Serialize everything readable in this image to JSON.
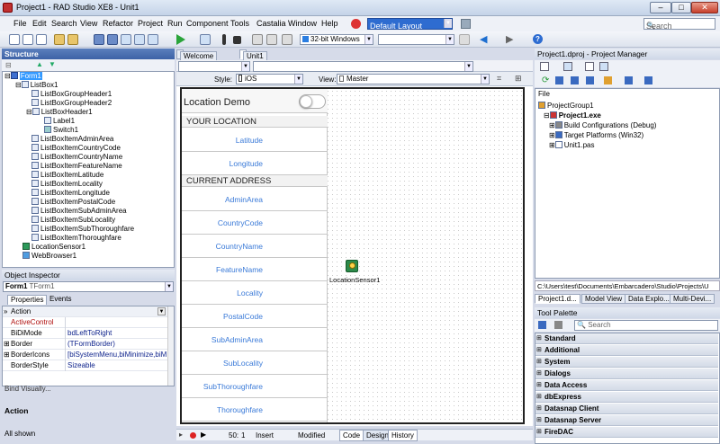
{
  "window": {
    "title": "Project1 - RAD Studio XE8 - Unit1"
  },
  "menu": [
    "File",
    "Edit",
    "Search",
    "View",
    "Refactor",
    "Project",
    "Run",
    "Component",
    "Tools",
    "Castalia",
    "Window",
    "Help"
  ],
  "toolbar": {
    "layout_combo": "Default Layout",
    "search_placeholder": "Search",
    "platform_combo": "32-bit Windows"
  },
  "structure": {
    "title": "Structure",
    "items": [
      "Form1",
      "ListBox1",
      "ListBoxGroupHeader1",
      "ListBoxGroupHeader2",
      "ListBoxHeader1",
      "Label1",
      "Switch1",
      "ListBoxItemAdminArea",
      "ListBoxItemCountryCode",
      "ListBoxItemCountryName",
      "ListBoxItemFeatureName",
      "ListBoxItemLatitude",
      "ListBoxItemLocality",
      "ListBoxItemLongitude",
      "ListBoxItemPostalCode",
      "ListBoxItemSubAdminArea",
      "ListBoxItemSubLocality",
      "ListBoxItemSubThoroughfare",
      "ListBoxItemThoroughfare",
      "LocationSensor1",
      "WebBrowser1"
    ]
  },
  "object_inspector": {
    "title": "Object Inspector",
    "object": "Form1",
    "object_type": "TForm1",
    "tabs": [
      "Properties",
      "Events"
    ],
    "search": "Action",
    "rows": [
      {
        "name": "ActiveControl",
        "value": ""
      },
      {
        "name": "BiDiMode",
        "value": "bdLeftToRight"
      },
      {
        "name": "Border",
        "value": "(TFormBorder)"
      },
      {
        "name": "BorderIcons",
        "value": "[biSystemMenu,biMinimize,biMa"
      },
      {
        "name": "BorderStyle",
        "value": "Sizeable"
      }
    ],
    "bind_visually": "Bind Visually...",
    "desc_title": "Action",
    "status": "All shown"
  },
  "editor": {
    "tabs": [
      "Welcome Page",
      "Unit1"
    ],
    "style_label": "Style:",
    "style_value": "iOS",
    "view_label": "View:",
    "view_value": "Master"
  },
  "form": {
    "title": "Location Demo",
    "header_location": "YOUR LOCATION",
    "header_address": "CURRENT ADDRESS",
    "location_items": [
      "Latitude",
      "Longitude"
    ],
    "address_items": [
      "AdminArea",
      "CountryCode",
      "CountryName",
      "FeatureName",
      "Locality",
      "PostalCode",
      "SubAdminArea",
      "SubLocality",
      "SubThoroughfare",
      "Thoroughfare"
    ],
    "sensor_label": "LocationSensor1"
  },
  "statusbar": {
    "line": "50:",
    "col": "1",
    "mode": "Insert",
    "modified": "Modified",
    "tabs": [
      "Code",
      "Design",
      "History"
    ]
  },
  "project_manager": {
    "title": "Project1.dproj - Project Manager",
    "file_label": "File",
    "items": [
      "ProjectGroup1",
      "Project1.exe",
      "Build Configurations (Debug)",
      "Target Platforms (Win32)",
      "Unit1.pas"
    ],
    "path": "C:\\Users\\test\\Documents\\Embarcadero\\Studio\\Projects\\U",
    "tabs": [
      "Project1.d...",
      "Model View",
      "Data Explo...",
      "Multi-Devi..."
    ]
  },
  "tool_palette": {
    "title": "Tool Palette",
    "search_placeholder": "Search",
    "categories": [
      "Standard",
      "Additional",
      "System",
      "Dialogs",
      "Data Access",
      "dbExpress",
      "Datasnap Client",
      "Datasnap Server",
      "FireDAC"
    ]
  }
}
